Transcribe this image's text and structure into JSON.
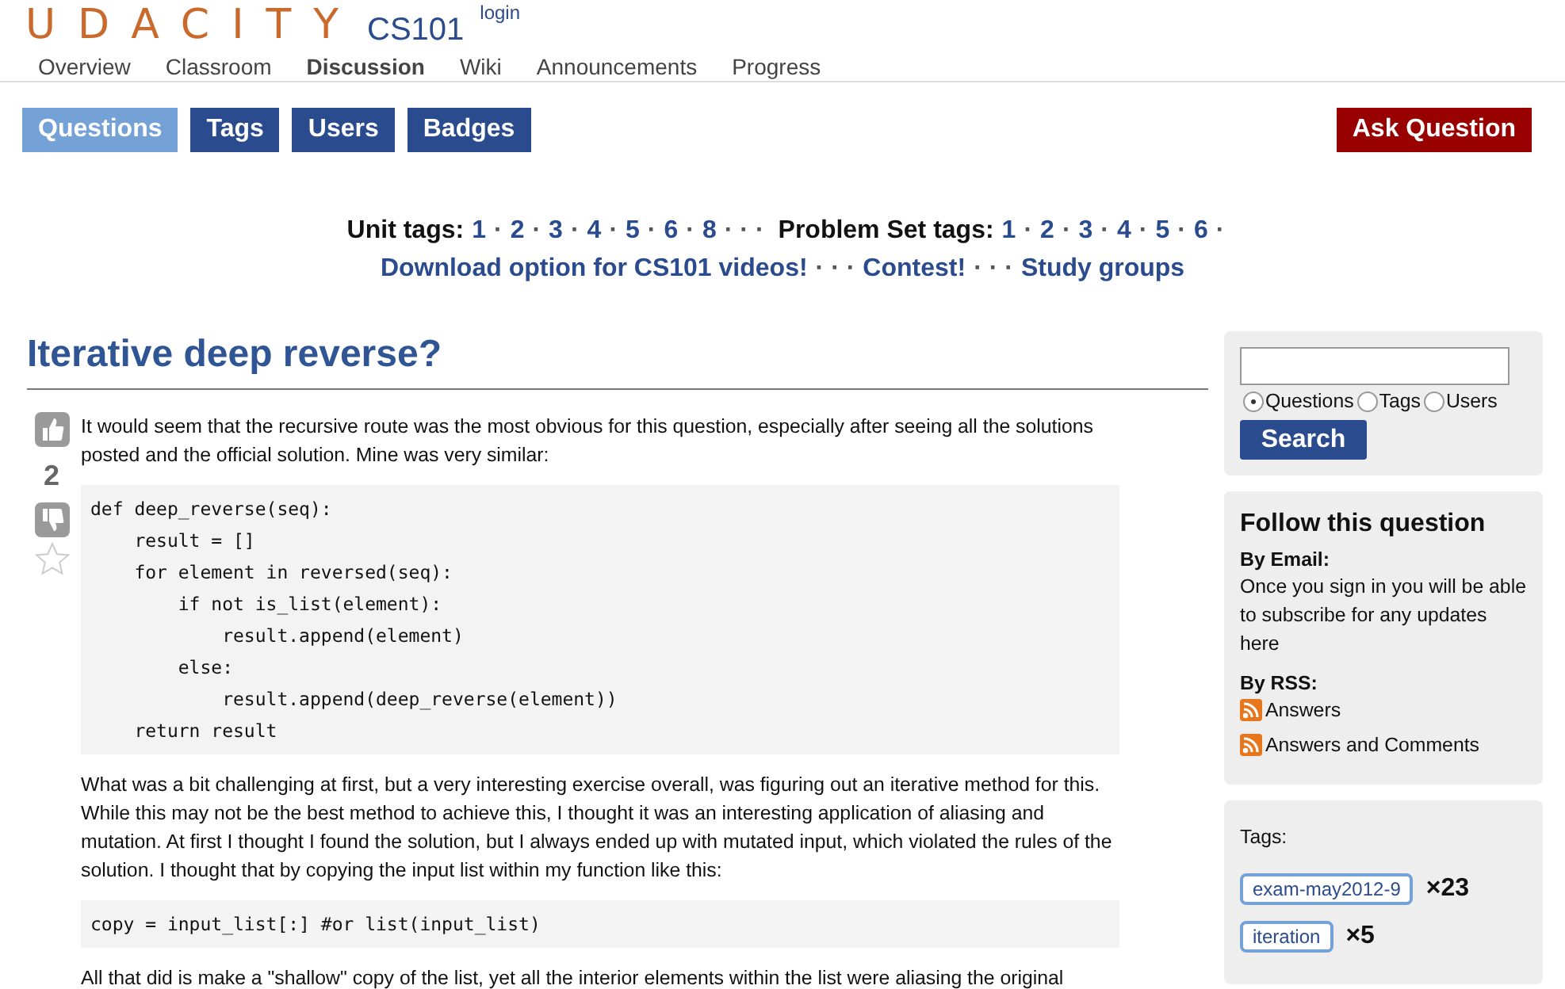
{
  "header": {
    "logo": "UDACITY",
    "course": "CS101",
    "login": "login"
  },
  "nav": [
    {
      "label": "Overview",
      "selected": false
    },
    {
      "label": "Classroom",
      "selected": false
    },
    {
      "label": "Discussion",
      "selected": true
    },
    {
      "label": "Wiki",
      "selected": false
    },
    {
      "label": "Announcements",
      "selected": false
    },
    {
      "label": "Progress",
      "selected": false
    }
  ],
  "subnav": [
    {
      "label": "Questions",
      "selected": true
    },
    {
      "label": "Tags",
      "selected": false
    },
    {
      "label": "Users",
      "selected": false
    },
    {
      "label": "Badges",
      "selected": false
    }
  ],
  "ask_button": "Ask Question",
  "tag_lines": [
    [
      {
        "kind": "label",
        "text": "Unit tags:"
      },
      {
        "kind": "link",
        "text": "1"
      },
      {
        "kind": "sep",
        "text": "·"
      },
      {
        "kind": "link",
        "text": "2"
      },
      {
        "kind": "sep",
        "text": "·"
      },
      {
        "kind": "link",
        "text": "3"
      },
      {
        "kind": "sep",
        "text": "·"
      },
      {
        "kind": "link",
        "text": "4"
      },
      {
        "kind": "sep",
        "text": "·"
      },
      {
        "kind": "link",
        "text": "5"
      },
      {
        "kind": "sep",
        "text": "·"
      },
      {
        "kind": "link",
        "text": "6"
      },
      {
        "kind": "sep",
        "text": "·"
      },
      {
        "kind": "link",
        "text": "8"
      },
      {
        "kind": "sep",
        "text": "· · ·"
      },
      {
        "kind": "label",
        "text": "Problem Set tags:"
      },
      {
        "kind": "link",
        "text": "1"
      },
      {
        "kind": "sep",
        "text": "·"
      },
      {
        "kind": "link",
        "text": "2"
      },
      {
        "kind": "sep",
        "text": "·"
      },
      {
        "kind": "link",
        "text": "3"
      },
      {
        "kind": "sep",
        "text": "·"
      },
      {
        "kind": "link",
        "text": "4"
      },
      {
        "kind": "sep",
        "text": "·"
      },
      {
        "kind": "link",
        "text": "5"
      },
      {
        "kind": "sep",
        "text": "·"
      },
      {
        "kind": "link",
        "text": "6"
      },
      {
        "kind": "sep",
        "text": "·"
      }
    ],
    [
      {
        "kind": "link",
        "text": "Download option for CS101 videos!"
      },
      {
        "kind": "sep",
        "text": "· · ·"
      },
      {
        "kind": "link",
        "text": "Contest!"
      },
      {
        "kind": "sep",
        "text": "· · ·"
      },
      {
        "kind": "link",
        "text": "Study groups"
      }
    ]
  ],
  "question": {
    "title": "Iterative deep reverse?",
    "votes": "2",
    "favorite": false,
    "body": [
      {
        "kind": "paragraph",
        "text": "It would seem that the recursive route was the most obvious for this question, especially after seeing all the solutions posted and the official solution. Mine was very similar:"
      },
      {
        "kind": "code",
        "lines": [
          "def deep_reverse(seq):",
          "    result = []",
          "    for element in reversed(seq):",
          "        if not is_list(element):",
          "            result.append(element)",
          "        else:",
          "            result.append(deep_reverse(element))",
          "    return result"
        ]
      },
      {
        "kind": "paragraph",
        "text": "What was a bit challenging at first, but a very interesting exercise overall, was figuring out an iterative method for this. While this may not be the best method to achieve this, I thought it was an interesting application of aliasing and mutation. At first I thought I found the solution, but I always ended up with mutated input, which violated the rules of the solution. I thought that by copying the input list within my function like this:"
      },
      {
        "kind": "code",
        "lines": [
          "copy = input_list[:] #or list(input_list)"
        ]
      },
      {
        "kind": "paragraph",
        "text": "All that did is make a \"shallow\" copy of the list, yet all the interior elements within the list were aliasing the original"
      }
    ]
  },
  "search": {
    "options": [
      {
        "label": "Questions",
        "selected": true
      },
      {
        "label": "Tags",
        "selected": false
      },
      {
        "label": "Users",
        "selected": false
      }
    ],
    "button": "Search"
  },
  "follow": {
    "title": "Follow this question",
    "email_label": "By Email:",
    "email_text": "Once you sign in you will be able to subscribe for any updates here",
    "rss_label": "By RSS:",
    "feeds": [
      "Answers",
      "Answers and Comments"
    ]
  },
  "tags": {
    "label": "Tags:",
    "items": [
      {
        "name": "exam-may2012-9",
        "count": "×23"
      },
      {
        "name": "iteration",
        "count": "×5"
      }
    ]
  }
}
